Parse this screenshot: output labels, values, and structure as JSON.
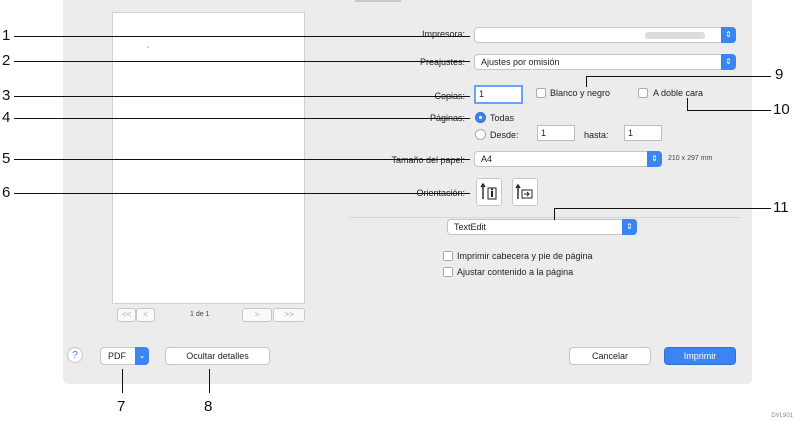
{
  "dialog": {
    "printer": {
      "label": "Impresora:",
      "value": ""
    },
    "presets": {
      "label": "Preajustes:",
      "value": "Ajustes por omisión"
    },
    "copies": {
      "label": "Copias:",
      "value": "1"
    },
    "black_white": {
      "label": "Blanco y negro",
      "checked": false
    },
    "two_sided": {
      "label": "A doble cara",
      "checked": false
    },
    "pages": {
      "label": "Páginas:",
      "all_label": "Todas",
      "from_label": "Desde:",
      "from_value": "1",
      "to_label": "hasta:",
      "to_value": "1",
      "selected": "all"
    },
    "paper_size": {
      "label": "Tamaño del papel:",
      "value": "A4",
      "dimensions": "210 x 297 mm"
    },
    "orientation": {
      "label": "Orientación:",
      "selected": "portrait"
    },
    "app_popup": {
      "value": "TextEdit"
    },
    "print_header_footer": {
      "label": "Imprimir cabecera y pie de página",
      "checked": false
    },
    "fit_content": {
      "label": "Ajustar contenido a la página",
      "checked": false
    },
    "preview": {
      "page_label": "1 de 1",
      "first": "<<",
      "prev": "<",
      "next": ">",
      "last": ">>"
    },
    "footer": {
      "help": "?",
      "pdf": "PDF",
      "hide_details": "Ocultar detalles",
      "cancel": "Cancelar",
      "print": "Imprimir"
    }
  },
  "callouts": [
    "1",
    "2",
    "3",
    "4",
    "5",
    "6",
    "7",
    "8",
    "9",
    "10",
    "11"
  ],
  "figure_code": "DVL901",
  "colors": {
    "accent": "#3a84f4",
    "dialog_bg": "#ececec"
  },
  "icons": [
    "chevron-updown-icon",
    "chevron-down-icon",
    "portrait-icon",
    "landscape-icon",
    "help-icon"
  ]
}
